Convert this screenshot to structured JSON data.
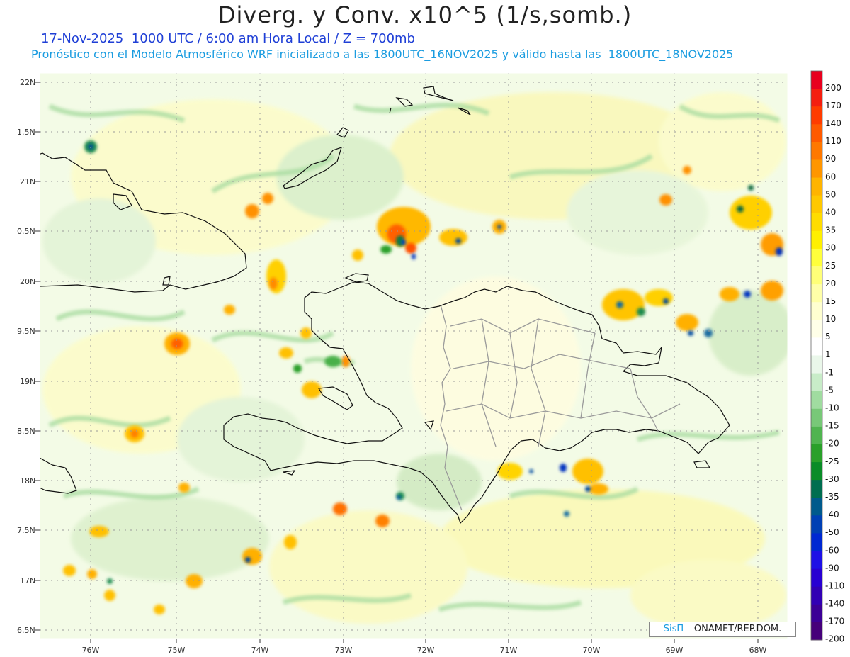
{
  "header": {
    "title": "Diverg. y Conv. x10^5 (1/s,somb.)",
    "subtitle1": "17-Nov-2025  1000 UTC / 6:00 am Hora Local / Z = 700mb",
    "subtitle2": "Pronóstico con el Modelo Atmosférico WRF inicializado a las 1800UTC_16NOV2025 y válido hasta las  1800UTC_18NOV2025"
  },
  "map": {
    "lat_labels": [
      "22N",
      "1.5N",
      "21N",
      "0.5N",
      "20N",
      "9.5N",
      "19N",
      "8.5N",
      "18N",
      "7.5N",
      "17N",
      "6.5N"
    ],
    "lon_labels": [
      "76W",
      "75W",
      "74W",
      "73W",
      "72W",
      "71W",
      "70W",
      "69W",
      "68W"
    ]
  },
  "colorbar": {
    "labels": [
      "200",
      "170",
      "140",
      "110",
      "90",
      "60",
      "50",
      "40",
      "35",
      "30",
      "25",
      "20",
      "15",
      "10",
      "5",
      "1",
      "-1",
      "-5",
      "-10",
      "-15",
      "-20",
      "-25",
      "-30",
      "-35",
      "-40",
      "-50",
      "-60",
      "-90",
      "-110",
      "-140",
      "-170",
      "-200"
    ],
    "colors": [
      "#e8001e",
      "#f41e10",
      "#ff3c00",
      "#ff5a00",
      "#ff7800",
      "#ff9600",
      "#ffb400",
      "#ffc800",
      "#ffdc00",
      "#fff000",
      "#ffff3c",
      "#ffff78",
      "#ffffa8",
      "#ffffd0",
      "#ffffe8",
      "#ffffff",
      "#eaf7ea",
      "#c8ecc8",
      "#a0dca0",
      "#78c878",
      "#50b450",
      "#2aa02a",
      "#0a8c28",
      "#006e50",
      "#005a8c",
      "#0040b4",
      "#0028d2",
      "#1e10e6",
      "#2800d2",
      "#3200b4",
      "#3c0096",
      "#46007a"
    ]
  },
  "credit": {
    "brand": "SisΠ",
    "text": " – ONAMET/REP.DOM."
  }
}
